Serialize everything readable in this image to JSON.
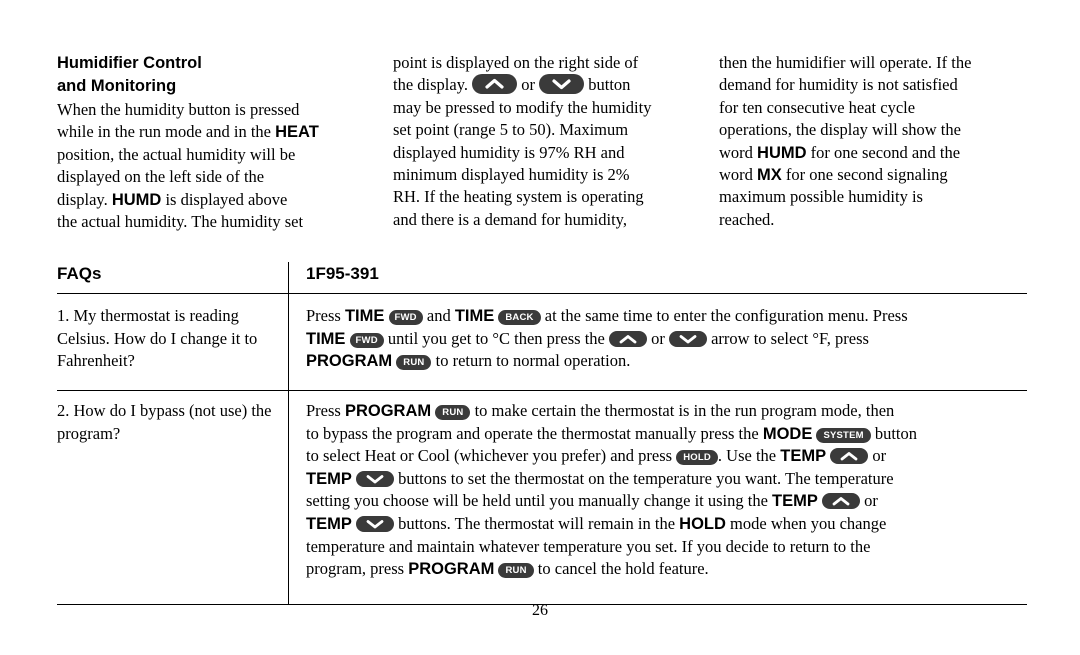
{
  "document": {
    "page_number": "26"
  },
  "section": {
    "heading_line1": "Humidifier Control",
    "heading_line2": "and Monitoring",
    "col1": {
      "l1": "When the humidity button is pressed",
      "l2a": "while in the run mode and in the ",
      "l2b": "HEAT",
      "l3": "position, the actual humidity will be",
      "l4": "displayed on the left side of the",
      "l5a": "display. ",
      "l5b": "HUMD",
      "l5c": " is displayed above",
      "l6": "the actual humidity. The humidity set"
    },
    "col2": {
      "l1": "point is displayed on the right side of",
      "l2a": "the display.",
      "l2b": "or",
      "l2c": "button",
      "l3": "may be pressed to modify the humidity",
      "l4": "set point (range 5 to 50). Maximum",
      "l5": "displayed humidity is 97% RH and",
      "l6": "minimum displayed humidity is 2%",
      "l7": "RH. If the heating system is operating",
      "l8": "and there is a demand for humidity,"
    },
    "col3": {
      "l1": "then the humidifier will operate. If the",
      "l2": "demand for humidity is not satisfied",
      "l3": "for ten consecutive heat cycle",
      "l4": "operations, the display will show the",
      "l5a": "word ",
      "l5b": "HUMD",
      "l5c": " for one second and the",
      "l6a": "word ",
      "l6b": "MX",
      "l6c": " for one second signaling",
      "l7": "maximum possible humidity is",
      "l8": "reached."
    }
  },
  "faq": {
    "header_left": "FAQs",
    "header_right": "1F95-391",
    "rows": [
      {
        "question_lines": [
          "1. My thermostat is reading",
          "Celsius. How do I change it",
          "to Fahrenheit?"
        ],
        "answer": {
          "l1_a": "Press ",
          "l1_time1": "TIME",
          "l1_fwd": "FWD",
          "l1_b": " and ",
          "l1_time2": "TIME",
          "l1_back": "BACK",
          "l1_c": " at the same time to enter the configuration menu. Press",
          "l2_time": "TIME",
          "l2_fwd": "FWD",
          "l2_a": " until you get to °C then press the ",
          "l2_b": " or ",
          "l2_c": " arrow to select °F, press",
          "l3_program": "PROGRAM",
          "l3_run": "RUN",
          "l3_a": " to return to normal operation."
        }
      },
      {
        "question_lines": [
          "2. How do I bypass (not",
          "use) the program?"
        ],
        "answer": {
          "l1_a": "Press ",
          "l1_program": "PROGRAM",
          "l1_run": "RUN",
          "l1_b": " to make certain the thermostat is in the run program mode, then",
          "l2_a": "to bypass the program and operate the thermostat manually press the ",
          "l2_mode": "MODE",
          "l2_system": "SYSTEM",
          "l2_b": " button",
          "l3_a": "to select Heat or Cool (whichever you prefer) and press ",
          "l3_hold": "HOLD",
          "l3_b": ". Use the ",
          "l3_temp": "TEMP",
          "l3_c": " or",
          "l4_temp": "TEMP",
          "l4_a": " buttons to set the thermostat on the temperature you want. The temperature",
          "l5_a": "setting you choose will be held until you manually change it using the ",
          "l5_temp": "TEMP",
          "l5_b": " or",
          "l6_temp": "TEMP",
          "l6_a": " buttons. The thermostat will remain in the ",
          "l6_hold": "HOLD",
          "l6_b": " mode when you change",
          "l7_a": "temperature and maintain whatever temperature you set. If you decide to return to the",
          "l8_a": "program, press ",
          "l8_program": "PROGRAM",
          "l8_run": "RUN",
          "l8_b": " to cancel the hold feature."
        }
      }
    ]
  },
  "colors": {
    "pill_background": "#3a3a3a",
    "pill_text": "#ffffff",
    "rule": "#000000"
  }
}
